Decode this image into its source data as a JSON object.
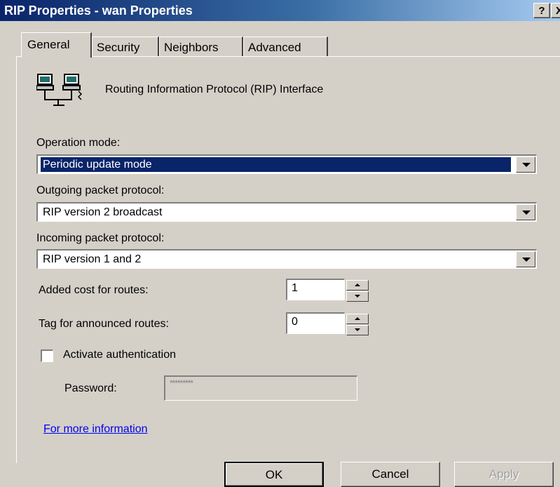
{
  "window": {
    "title": "RIP Properties - wan Properties",
    "help_label": "?",
    "close_label": "X"
  },
  "tabs": [
    {
      "label": "General",
      "active": true
    },
    {
      "label": "Security",
      "active": false
    },
    {
      "label": "Neighbors",
      "active": false
    },
    {
      "label": "Advanced",
      "active": false
    }
  ],
  "header": {
    "icon": "network-computers-icon",
    "title": "Routing Information Protocol (RIP) Interface"
  },
  "operation_mode": {
    "label": "Operation mode:",
    "value": "Periodic update mode"
  },
  "outgoing": {
    "label": "Outgoing packet protocol:",
    "value": "RIP version 2 broadcast"
  },
  "incoming": {
    "label": "Incoming packet protocol:",
    "value": "RIP version 1 and 2"
  },
  "added_cost": {
    "label": "Added cost for routes:",
    "value": "1"
  },
  "route_tag": {
    "label": "Tag for announced routes:",
    "value": "0"
  },
  "authentication": {
    "label": "Activate authentication",
    "checked": false,
    "password_label": "Password:",
    "password_value": "*********"
  },
  "more_info": "For more information",
  "buttons": {
    "ok": "OK",
    "cancel": "Cancel",
    "apply": "Apply"
  },
  "colors": {
    "face": "#d4d0c8",
    "title_start": "#0a246a",
    "selection": "#0a246a",
    "link": "#0000ee"
  }
}
